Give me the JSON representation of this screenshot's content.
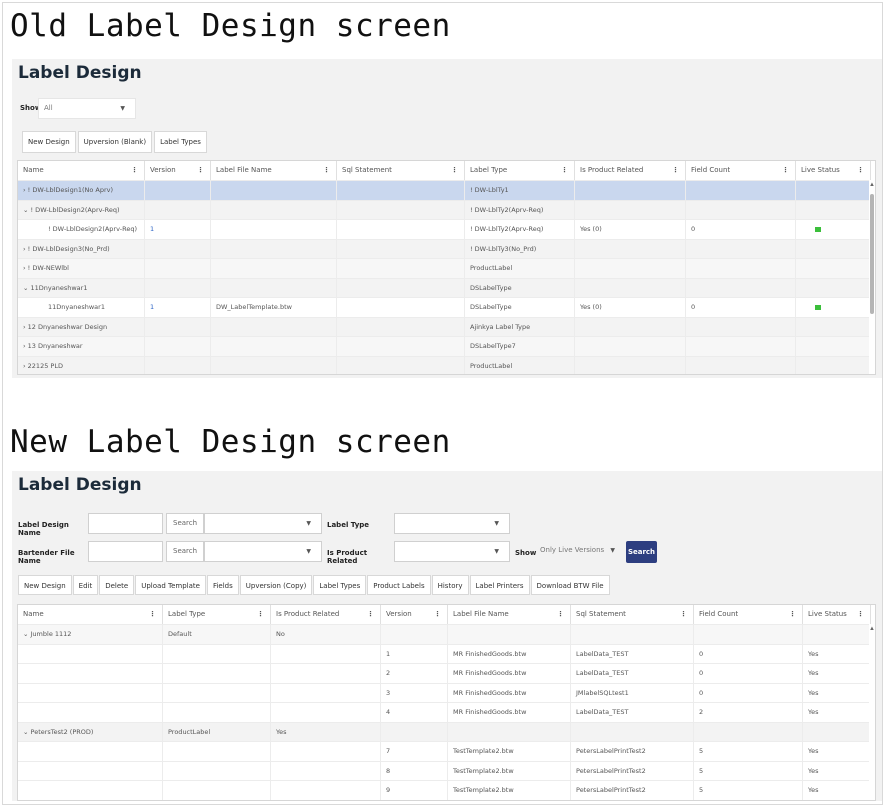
{
  "old": {
    "heading": "Old Label Design screen",
    "title": "Label Design",
    "show_label": "Show",
    "show_value": "All",
    "buttons": [
      "New Design",
      "Upversion (Blank)",
      "Label Types"
    ],
    "columns": [
      "Name",
      "Version",
      "Label File Name",
      "Sql Statement",
      "Label Type",
      "Is Product Related",
      "Field Count",
      "Live Status"
    ],
    "rows": [
      {
        "name": "› ! DW-LblDesign1(No Aprv)",
        "version": "",
        "file": "",
        "sql": "",
        "type": "! DW-LblTy1",
        "prod": "",
        "count": "",
        "live": false,
        "selected": true
      },
      {
        "name": "⌄ ! DW-LblDesign2(Aprv-Req)",
        "version": "",
        "file": "",
        "sql": "",
        "type": "! DW-LblTy2(Aprv-Req)",
        "prod": "",
        "count": "",
        "live": false
      },
      {
        "name": "! DW-LblDesign2(Aprv-Req)",
        "version": "1",
        "file": "",
        "sql": "",
        "type": "! DW-LblTy2(Aprv-Req)",
        "prod": "Yes (0)",
        "count": "0",
        "live": true,
        "child": true
      },
      {
        "name": "› ! DW-LblDesign3(No_Prd)",
        "version": "",
        "file": "",
        "sql": "",
        "type": "! DW-LblTy3(No_Prd)",
        "prod": "",
        "count": "",
        "live": false
      },
      {
        "name": "› ! DW-NEWlbl",
        "version": "",
        "file": "",
        "sql": "",
        "type": "ProductLabel",
        "prod": "",
        "count": "",
        "live": false
      },
      {
        "name": "⌄ 11Dnyaneshwar1",
        "version": "",
        "file": "",
        "sql": "",
        "type": "DSLabelType",
        "prod": "",
        "count": "",
        "live": false
      },
      {
        "name": "11Dnyaneshwar1",
        "version": "1",
        "file": "DW_LabelTemplate.btw",
        "sql": "",
        "type": "DSLabelType",
        "prod": "Yes (0)",
        "count": "0",
        "live": true,
        "child": true
      },
      {
        "name": "› 12 Dnyaneshwar Design",
        "version": "",
        "file": "",
        "sql": "",
        "type": "Ajinkya Label Type",
        "prod": "",
        "count": "",
        "live": false
      },
      {
        "name": "› 13 Dnyaneshwar",
        "version": "",
        "file": "",
        "sql": "",
        "type": "DSLabelType7",
        "prod": "",
        "count": "",
        "live": false
      },
      {
        "name": "› 22125 PLD",
        "version": "",
        "file": "",
        "sql": "",
        "type": "ProductLabel",
        "prod": "",
        "count": "",
        "live": false
      }
    ]
  },
  "new": {
    "heading": "New Label Design screen",
    "title": "Label Design",
    "filters": {
      "design_name_label": "Label Design Name",
      "bartender_label": "Bartender File Name",
      "search": "Search",
      "label_type_label": "Label Type",
      "is_product_label": "Is Product Related",
      "show_label": "Show",
      "show_value": "Only Live Versions",
      "search_button": "Search"
    },
    "buttons": [
      "New Design",
      "Edit",
      "Delete",
      "Upload Template",
      "Fields",
      "Upversion (Copy)",
      "Label Types",
      "Product Labels",
      "History",
      "Label Printers",
      "Download BTW File"
    ],
    "columns": [
      "Name",
      "Label Type",
      "Is Product Related",
      "Version",
      "Label File Name",
      "Sql Statement",
      "Field Count",
      "Live Status"
    ],
    "rows": [
      {
        "name": "⌄ Jumble 1112",
        "type": "Default",
        "prod": "No",
        "version": "",
        "file": "",
        "sql": "",
        "count": "",
        "live": ""
      },
      {
        "name": "",
        "type": "",
        "prod": "",
        "version": "1",
        "file": "MR FinishedGoods.btw",
        "sql": "LabelData_TEST",
        "count": "0",
        "live": "Yes"
      },
      {
        "name": "",
        "type": "",
        "prod": "",
        "version": "2",
        "file": "MR FinishedGoods.btw",
        "sql": "LabelData_TEST",
        "count": "0",
        "live": "Yes"
      },
      {
        "name": "",
        "type": "",
        "prod": "",
        "version": "3",
        "file": "MR FinishedGoods.btw",
        "sql": "JMlabelSQLtest1",
        "count": "0",
        "live": "Yes"
      },
      {
        "name": "",
        "type": "",
        "prod": "",
        "version": "4",
        "file": "MR FinishedGoods.btw",
        "sql": "LabelData_TEST",
        "count": "2",
        "live": "Yes"
      },
      {
        "name": "⌄ PetersTest2 (PROD)",
        "type": "ProductLabel",
        "prod": "Yes",
        "version": "",
        "file": "",
        "sql": "",
        "count": "",
        "live": ""
      },
      {
        "name": "",
        "type": "",
        "prod": "",
        "version": "7",
        "file": "TestTemplate2.btw",
        "sql": "PetersLabelPrintTest2",
        "count": "5",
        "live": "Yes"
      },
      {
        "name": "",
        "type": "",
        "prod": "",
        "version": "8",
        "file": "TestTemplate2.btw",
        "sql": "PetersLabelPrintTest2",
        "count": "5",
        "live": "Yes"
      },
      {
        "name": "",
        "type": "",
        "prod": "",
        "version": "9",
        "file": "TestTemplate2.btw",
        "sql": "PetersLabelPrintTest2",
        "count": "5",
        "live": "Yes"
      }
    ]
  }
}
